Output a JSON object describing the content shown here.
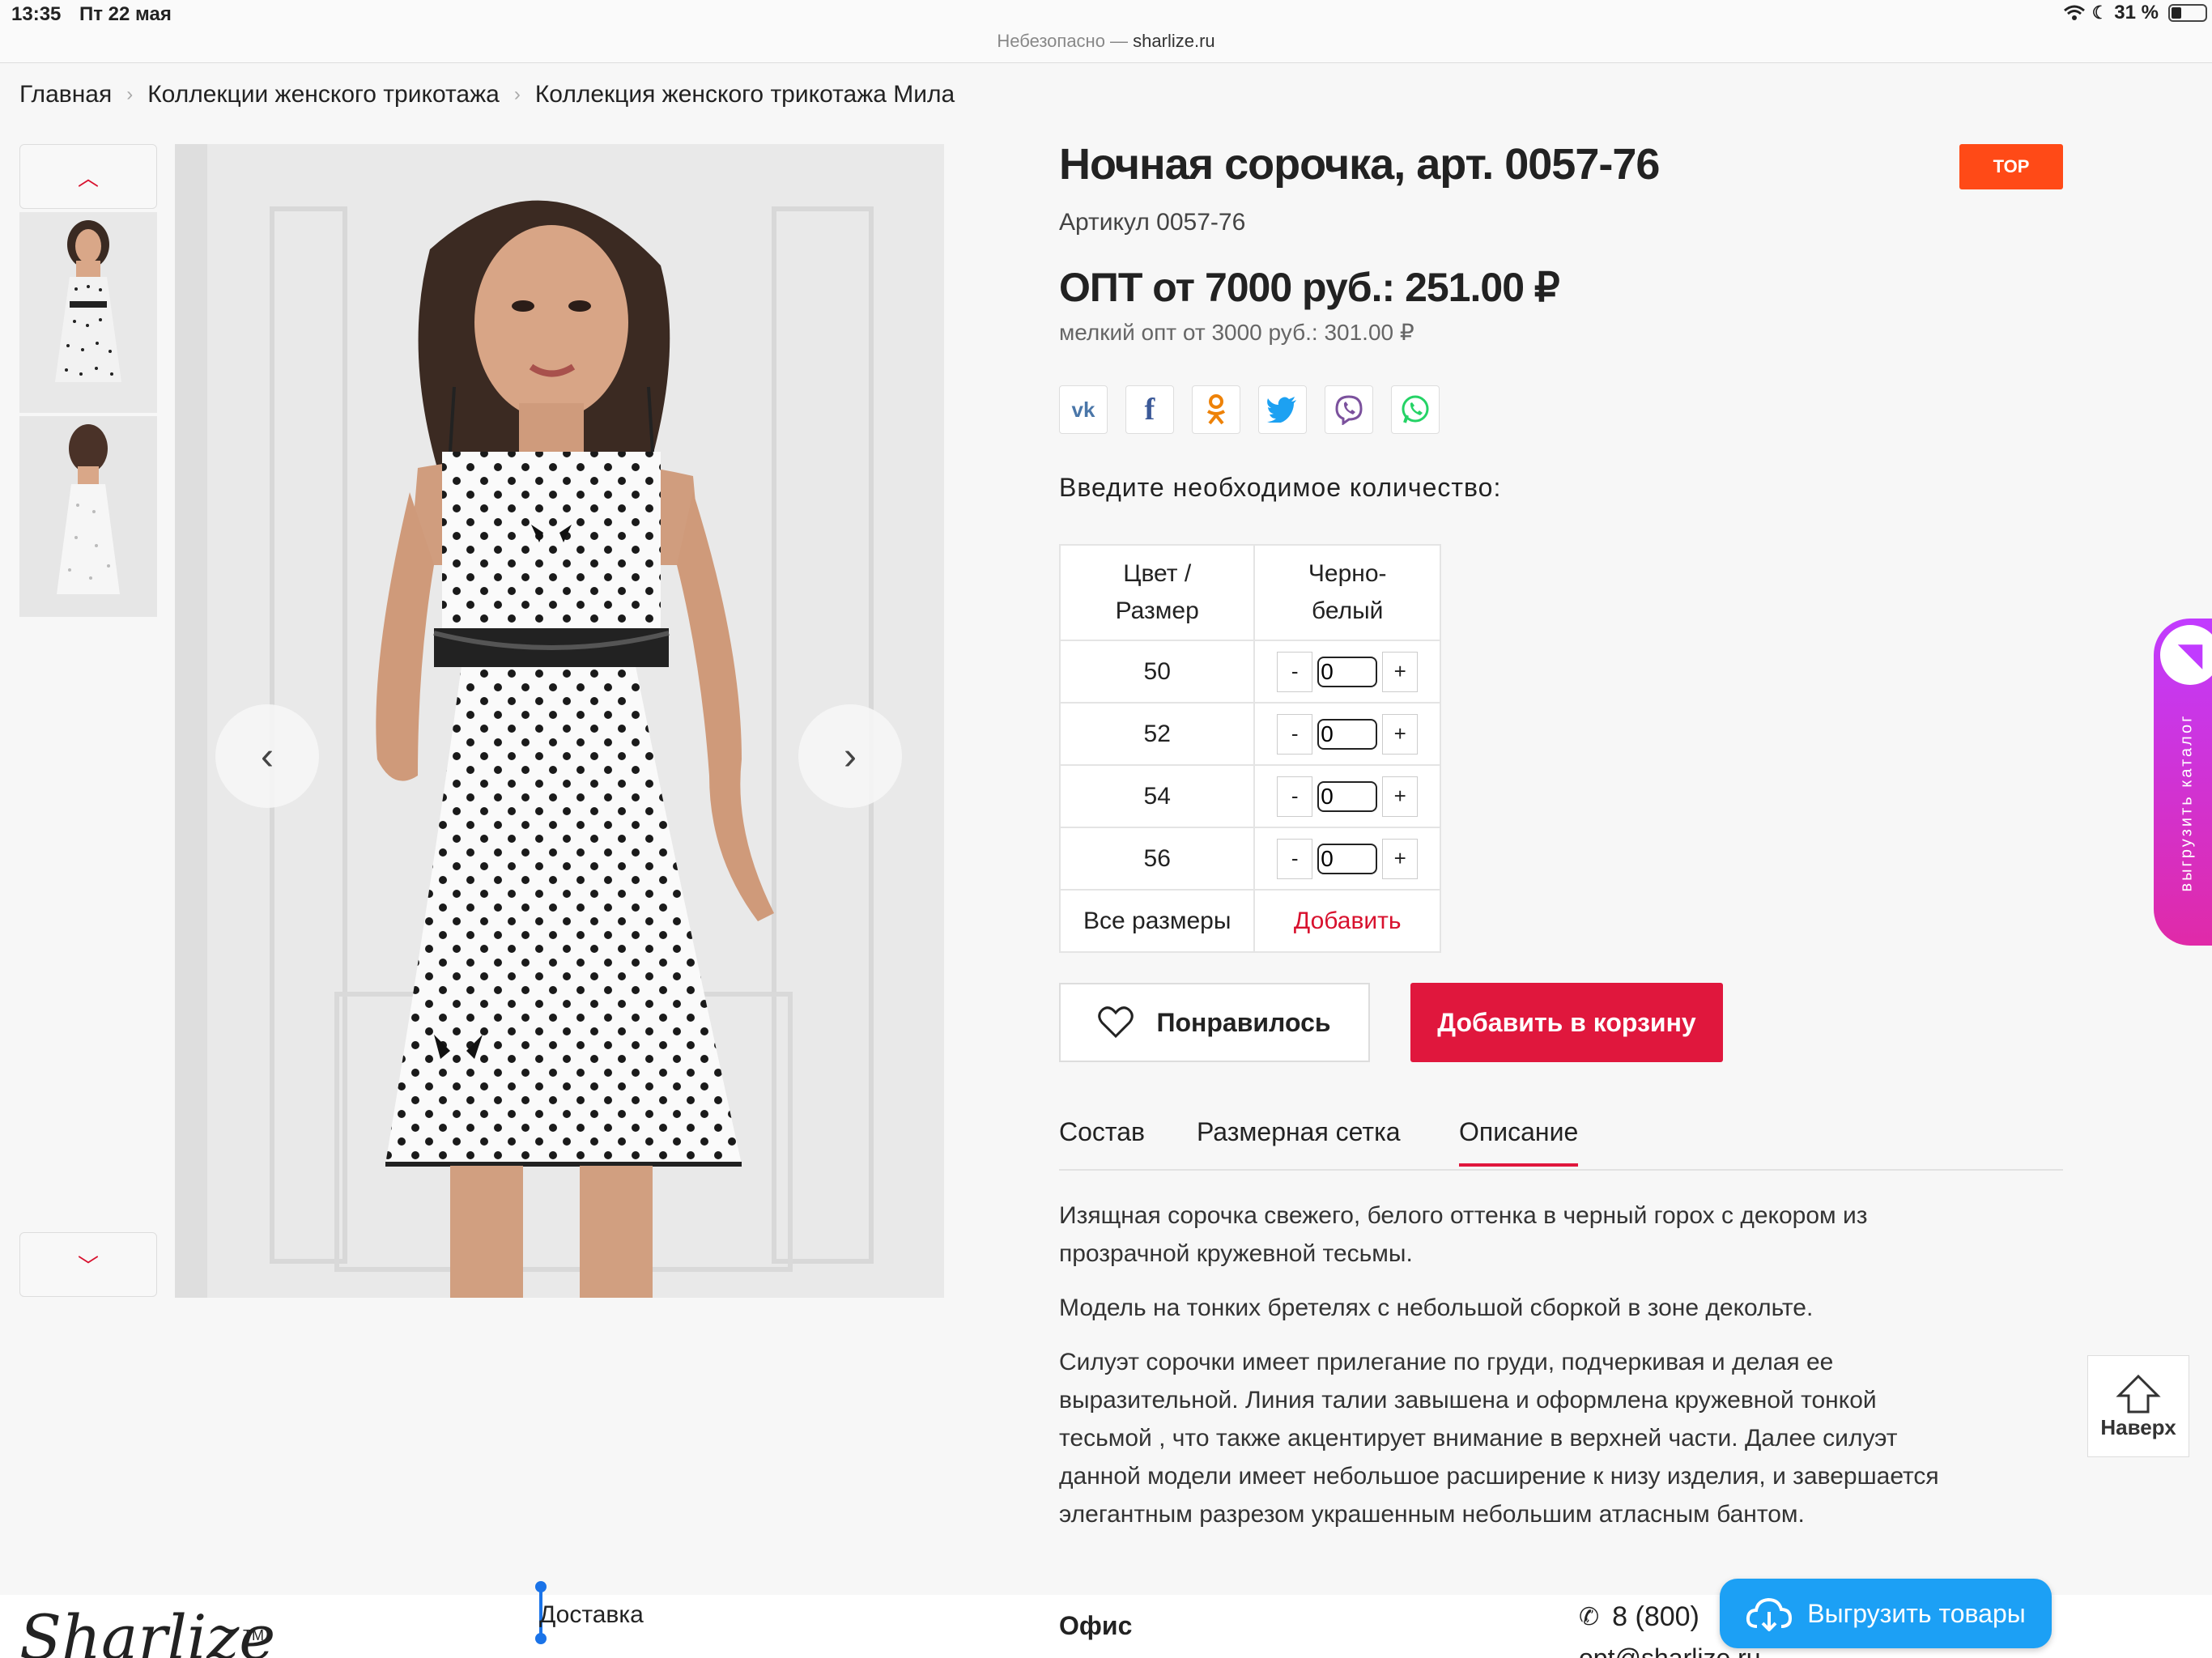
{
  "status": {
    "time": "13:35",
    "date": "Пт 22 мая",
    "url_prefix": "Небезопасно — ",
    "url_host": "sharlize.ru",
    "battery": "31 %",
    "battery_level": 0.31
  },
  "breadcrumbs": [
    "Главная",
    "Коллекции женского трикотажа",
    "Коллекция женского трикотажа Мила"
  ],
  "product": {
    "title": "Ночная сорочка, арт. 0057-76",
    "badge": "TOP",
    "sku": "Артикул 0057-76",
    "price": "ОПТ от 7000 руб.: 251.00 ₽",
    "price_small": "мелкий опт от 3000 руб.: 301.00 ₽"
  },
  "social": [
    "vk-icon",
    "facebook-icon",
    "odnoklassniki-icon",
    "twitter-icon",
    "viber-icon",
    "whatsapp-icon"
  ],
  "quantity": {
    "label": "Введите необходимое количество:",
    "header_left_1": "Цвет /",
    "header_left_2": "Размер",
    "header_right_1": "Черно-",
    "header_right_2": "белый",
    "rows": [
      {
        "size": "50",
        "qty": "0"
      },
      {
        "size": "52",
        "qty": "0"
      },
      {
        "size": "54",
        "qty": "0"
      },
      {
        "size": "56",
        "qty": "0"
      }
    ],
    "minus": "-",
    "plus": "+",
    "all_sizes": "Все размеры",
    "add_link": "Добавить"
  },
  "buttons": {
    "like": "Понравилось",
    "cart": "Добавить в корзину"
  },
  "tabs": {
    "composition": "Состав",
    "size_chart": "Размерная сетка",
    "description": "Описание",
    "active": "description"
  },
  "description": [
    "Изящная сорочка свежего, белого оттенка в черный горох с декором из прозрачной кружевной тесьмы.",
    "Модель на тонких бретелях с небольшой сборкой в зоне декольте.",
    "Силуэт сорочки имеет прилегание по груди, подчеркивая и делая ее выразительной. Линия талии завышена и оформлена кружевной тонкой тесьмой , что также акцентирует внимание в верхней части. Далее силуэт данной модели имеет небольшое расширение к низу изделия, и завершается элегантным разрезом украшенным небольшим атласным бантом."
  ],
  "side_tab": {
    "text": "выгрузить каталог"
  },
  "up_button": {
    "label": "Наверх"
  },
  "footer": {
    "logo": "Sharlize",
    "tm": "TM",
    "delivery": "Доставка",
    "office": "Офис",
    "phone": "8 (800)",
    "email": "opt@sharlize.ru",
    "export": "Выгрузить товары"
  },
  "colors": {
    "accent": "#e0173d",
    "badge": "#ff4a17",
    "side_tab": "#c13bff",
    "export": "#1ca0f5"
  }
}
